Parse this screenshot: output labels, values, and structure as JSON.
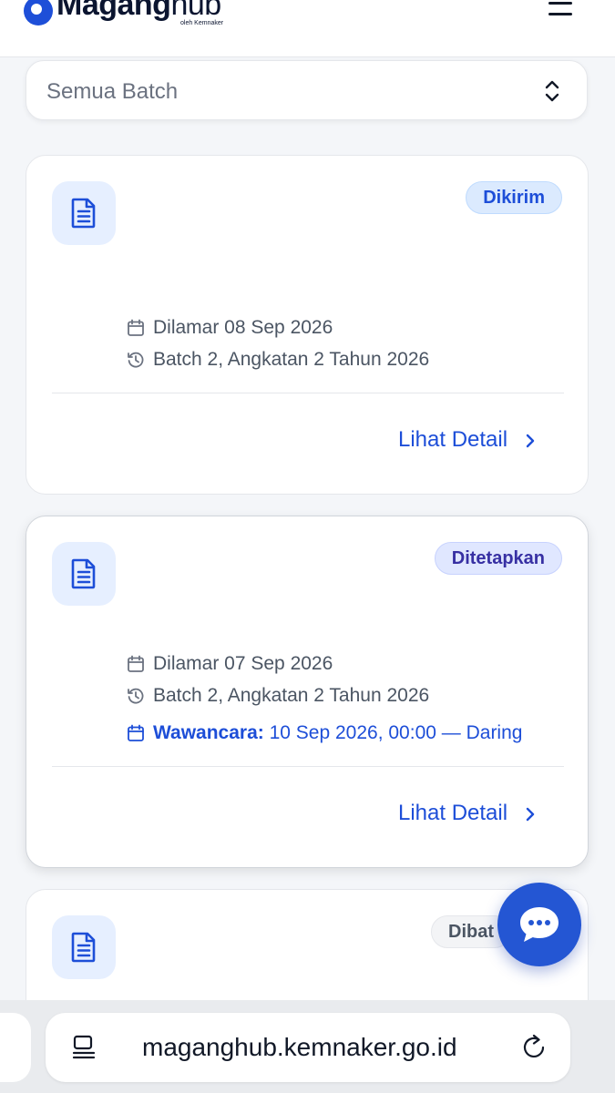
{
  "header": {
    "logo_main": "Magang",
    "logo_hub": "hub",
    "logo_sub": "oleh Kemnaker",
    "menu_icon": "hamburger-icon"
  },
  "filter": {
    "batch_value": "Semua Batch",
    "icon": "chevron-up-down-icon"
  },
  "applications": [
    {
      "status": "Dikirim",
      "status_color": "#1d4ed8",
      "applied": "Dilamar 08 Sep 2026",
      "batch": "Batch 2, Angkatan 2 Tahun 2026",
      "detail_label": "Lihat Detail"
    },
    {
      "status": "Ditetapkan",
      "status_color": "#3730a3",
      "applied": "Dilamar 07 Sep 2026",
      "batch": "Batch 2, Angkatan 2 Tahun 2026",
      "interview_label": "Wawancara:",
      "interview_value": " 10 Sep 2026, 00:00 — Daring",
      "detail_label": "Lihat Detail"
    },
    {
      "status": "Dibat",
      "status_color": "#4b5563"
    }
  ],
  "chat_button": {
    "icon": "chat-bubble-icon"
  },
  "browser": {
    "url": "maganghub.kemnaker.go.id",
    "tabs_icon": "tabs-icon",
    "reload_icon": "reload-icon"
  },
  "colors": {
    "accent": "#1d4ed8",
    "fab": "#2456d3",
    "background": "#f4f6f9"
  }
}
